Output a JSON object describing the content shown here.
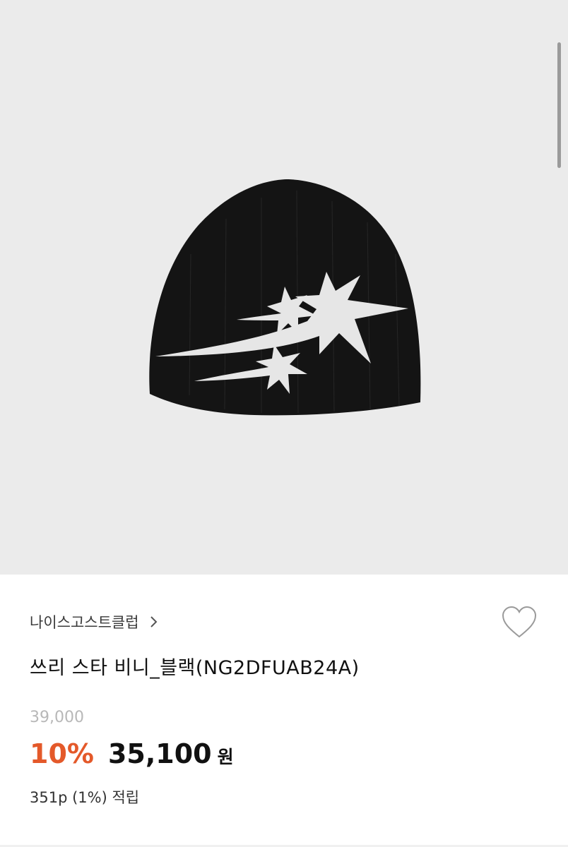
{
  "product": {
    "brand": "나이스고스트클럽",
    "name": "쓰리 스타 비니_블랙(NG2DFUAB24A)",
    "original_price": "39,000",
    "discount_rate": "10%",
    "price": "35,100",
    "currency": "원",
    "points": "351p (1%) 적립"
  },
  "icons": {
    "brand_arrow": "chevron-right-icon",
    "wishlist": "heart-outline-icon"
  },
  "colors": {
    "discount": "#e4592a",
    "hero_background": "#ebebeb"
  }
}
